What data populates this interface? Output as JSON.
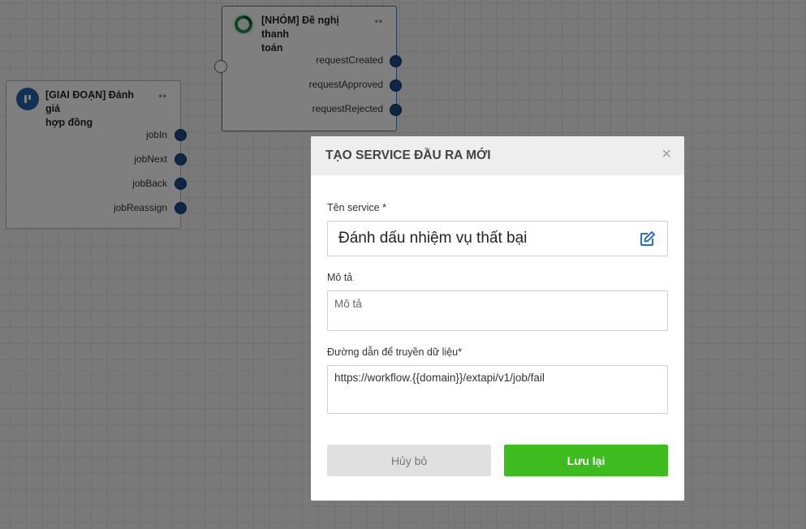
{
  "canvas": {
    "nodes": [
      {
        "title": "[GIAI ĐOẠN] Đánh giá hợp đồng",
        "title_line1": "[GIAI ĐOẠN] Đánh giá",
        "title_line2": "hợp đồng",
        "icon": "stage-icon",
        "icon_color": "#2563a8",
        "outputs": [
          "jobIn",
          "jobNext",
          "jobBack",
          "jobReassign"
        ]
      },
      {
        "title": "[NHÓM] Đề nghị thanh toán",
        "title_line1": "[NHÓM] Đề nghị thanh",
        "title_line2": "toán",
        "icon": "refresh-icon",
        "icon_color": "#1a8a4a",
        "outputs": [
          "requestCreated",
          "requestApproved",
          "requestRejected"
        ]
      }
    ]
  },
  "modal": {
    "title": "TẠO SERVICE ĐẦU RA MỚI",
    "close_label": "×",
    "fields": {
      "name_label": "Tên service *",
      "name_value": "Đánh dấu nhiệm vụ thất bại",
      "description_label": "Mô tả",
      "description_placeholder": "Mô tả",
      "description_value": "",
      "url_label": "Đường dẫn để truyền dữ liệu*",
      "url_value": "https://workflow.{{domain}}/extapi/v1/job/fail"
    },
    "buttons": {
      "cancel_label": "Hủy bỏ",
      "save_label": "Lưu lại"
    }
  },
  "colors": {
    "accent_save": "#3ebb1e",
    "port": "#1d4c8c",
    "edit_icon": "#2a6fd6"
  }
}
